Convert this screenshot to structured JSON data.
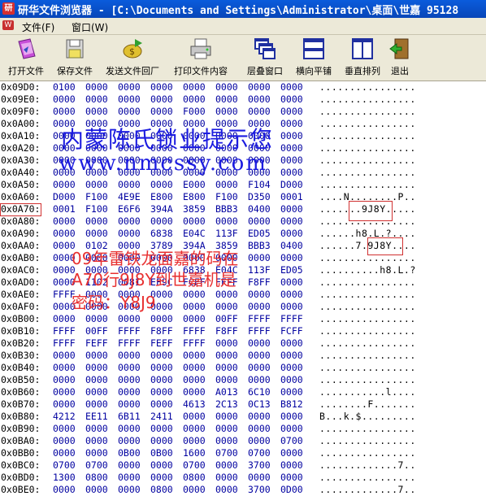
{
  "window": {
    "title": "研华文件浏览器 - [C:\\Documents and Settings\\Administrator\\桌面\\世嘉 95128",
    "colors": {
      "titlebar": "#0a5cdc",
      "chrome": "#ece9d8",
      "hex_values": "#0000a0",
      "highlight_box": "#d03030"
    }
  },
  "menu": {
    "items": [
      "文件(F)",
      "窗口(W)"
    ]
  },
  "toolbar": {
    "buttons": [
      {
        "label": "打开文件",
        "icon": "open-folder-icon"
      },
      {
        "label": "保存文件",
        "icon": "save-disk-icon"
      },
      {
        "label": "发送文件回厂",
        "icon": "send-icon"
      },
      {
        "label": "打印文件内容",
        "icon": "printer-icon"
      },
      {
        "label": "层叠窗口",
        "icon": "cascade-windows-icon"
      },
      {
        "label": "横向平铺",
        "icon": "tile-horizontal-icon"
      },
      {
        "label": "垂直排列",
        "icon": "tile-vertical-icon"
      },
      {
        "label": "退出",
        "icon": "exit-door-icon"
      }
    ]
  },
  "hex_rows": [
    {
      "addr": "0x09D0:",
      "values": [
        "0100",
        "0000",
        "0000",
        "0000",
        "0000",
        "0000",
        "0000",
        "0000"
      ],
      "ascii": "................"
    },
    {
      "addr": "0x09E0:",
      "values": [
        "0000",
        "0000",
        "0000",
        "0000",
        "0000",
        "0000",
        "0000",
        "0000"
      ],
      "ascii": "................"
    },
    {
      "addr": "0x09F0:",
      "values": [
        "0000",
        "0000",
        "0000",
        "0000",
        "F000",
        "0000",
        "0000",
        "0000"
      ],
      "ascii": "................"
    },
    {
      "addr": "0x0A00:",
      "values": [
        "0000",
        "0000",
        "0000",
        "0000",
        "0000",
        "0000",
        "0000",
        "0000"
      ],
      "ascii": "................"
    },
    {
      "addr": "0x0A10:",
      "values": [
        "0000",
        "0000",
        "0000",
        "0000",
        "0000",
        "0000",
        "0000",
        "0000"
      ],
      "ascii": "................"
    },
    {
      "addr": "0x0A20:",
      "values": [
        "0000",
        "0000",
        "0000",
        "0000",
        "0000",
        "0000",
        "0000",
        "0000"
      ],
      "ascii": "................"
    },
    {
      "addr": "0x0A30:",
      "values": [
        "0000",
        "0000",
        "0000",
        "0000",
        "0000",
        "0000",
        "0000",
        "0000"
      ],
      "ascii": "................"
    },
    {
      "addr": "0x0A40:",
      "values": [
        "0000",
        "0000",
        "0000",
        "0000",
        "0000",
        "0000",
        "0000",
        "0000"
      ],
      "ascii": "................"
    },
    {
      "addr": "0x0A50:",
      "values": [
        "0000",
        "0000",
        "0000",
        "0000",
        "E000",
        "0000",
        "F104",
        "D000"
      ],
      "ascii": "................"
    },
    {
      "addr": "0x0A60:",
      "values": [
        "D000",
        "F100",
        "4E9E",
        "E800",
        "E800",
        "F100",
        "D350",
        "0001"
      ],
      "ascii": "....N........P.."
    },
    {
      "addr": "0x0A70:",
      "values": [
        "0001",
        "F100",
        "E6F6",
        "394A",
        "3859",
        "BBB3",
        "0400",
        "0000"
      ],
      "ascii": ".......9J8Y....."
    },
    {
      "addr": "0x0A80:",
      "values": [
        "0000",
        "0000",
        "0000",
        "0000",
        "0000",
        "0000",
        "0000",
        "0000"
      ],
      "ascii": "................"
    },
    {
      "addr": "0x0A90:",
      "values": [
        "0000",
        "0000",
        "0000",
        "6838",
        "E04C",
        "113F",
        "ED05",
        "0000"
      ],
      "ascii": "......h8.L.?...."
    },
    {
      "addr": "0x0AA0:",
      "values": [
        "0000",
        "0102",
        "0000",
        "3789",
        "394A",
        "3859",
        "BBB3",
        "0400"
      ],
      "ascii": "......7.9J8Y...."
    },
    {
      "addr": "0x0AB0:",
      "values": [
        "0000",
        "0000",
        "0000",
        "0000",
        "0000",
        "0000",
        "0000",
        "0000"
      ],
      "ascii": "................"
    },
    {
      "addr": "0x0AC0:",
      "values": [
        "0000",
        "0000",
        "0000",
        "0000",
        "6838",
        "E04C",
        "113F",
        "ED05"
      ],
      "ascii": "..........h8.L.?"
    },
    {
      "addr": "0x0AD0:",
      "values": [
        "0000",
        "1102",
        "0081",
        "EF9C",
        "FCFF",
        "FFFF",
        "F8FF",
        "0000"
      ],
      "ascii": "................"
    },
    {
      "addr": "0x0AE0:",
      "values": [
        "FFFF",
        "0000",
        "0000",
        "0000",
        "0000",
        "0000",
        "0000",
        "0000"
      ],
      "ascii": "................"
    },
    {
      "addr": "0x0AF0:",
      "values": [
        "0000",
        "0000",
        "0000",
        "0000",
        "0000",
        "0000",
        "0000",
        "0000"
      ],
      "ascii": "................"
    },
    {
      "addr": "0x0B00:",
      "values": [
        "0000",
        "0000",
        "0000",
        "0000",
        "0000",
        "00FF",
        "FFFF",
        "FFFF"
      ],
      "ascii": "................"
    },
    {
      "addr": "0x0B10:",
      "values": [
        "FFFF",
        "00FF",
        "FFFF",
        "F8FF",
        "FFFF",
        "F8FF",
        "FFFF",
        "FCFF"
      ],
      "ascii": "................"
    },
    {
      "addr": "0x0B20:",
      "values": [
        "FFFF",
        "FEFF",
        "FFFF",
        "FEFF",
        "FFFF",
        "0000",
        "0000",
        "0000"
      ],
      "ascii": "................"
    },
    {
      "addr": "0x0B30:",
      "values": [
        "0000",
        "0000",
        "0000",
        "0000",
        "0000",
        "0000",
        "0000",
        "0000"
      ],
      "ascii": "................"
    },
    {
      "addr": "0x0B40:",
      "values": [
        "0000",
        "0000",
        "0000",
        "0000",
        "0000",
        "0000",
        "0000",
        "0000"
      ],
      "ascii": "................"
    },
    {
      "addr": "0x0B50:",
      "values": [
        "0000",
        "0000",
        "0000",
        "0000",
        "0000",
        "0000",
        "0000",
        "0000"
      ],
      "ascii": "................"
    },
    {
      "addr": "0x0B60:",
      "values": [
        "0000",
        "0000",
        "0000",
        "0000",
        "0000",
        "A013",
        "6C10",
        "0000"
      ],
      "ascii": "...........l...."
    },
    {
      "addr": "0x0B70:",
      "values": [
        "0000",
        "0000",
        "0000",
        "0000",
        "4613",
        "2C13",
        "0C13",
        "B812"
      ],
      "ascii": "........F......."
    },
    {
      "addr": "0x0B80:",
      "values": [
        "4212",
        "EE11",
        "6B11",
        "2411",
        "0000",
        "0000",
        "0000",
        "0000"
      ],
      "ascii": "B...k.$........."
    },
    {
      "addr": "0x0B90:",
      "values": [
        "0000",
        "0000",
        "0000",
        "0000",
        "0000",
        "0000",
        "0000",
        "0000"
      ],
      "ascii": "................"
    },
    {
      "addr": "0x0BA0:",
      "values": [
        "0000",
        "0000",
        "0000",
        "0000",
        "0000",
        "0000",
        "0000",
        "0700"
      ],
      "ascii": "................"
    },
    {
      "addr": "0x0BB0:",
      "values": [
        "0000",
        "0000",
        "0B00",
        "0B00",
        "1600",
        "0700",
        "0700",
        "0000"
      ],
      "ascii": "................"
    },
    {
      "addr": "0x0BC0:",
      "values": [
        "0700",
        "0700",
        "0000",
        "0000",
        "0700",
        "0000",
        "3700",
        "0000"
      ],
      "ascii": ".............7.."
    },
    {
      "addr": "0x0BD0:",
      "values": [
        "1300",
        "0800",
        "0000",
        "0000",
        "0800",
        "0000",
        "0000",
        "0000"
      ],
      "ascii": "................"
    },
    {
      "addr": "0x0BE0:",
      "values": [
        "0000",
        "0000",
        "0000",
        "0800",
        "0000",
        "0000",
        "3700",
        "0D00"
      ],
      "ascii": ".............7.."
    }
  ],
  "watermark": {
    "line1": "内蒙陈氏锁业提示您",
    "line2": "www.nmcssy.com",
    "red_line1": "09年雷铁龙面嘉的码在",
    "red_line2": "A70行9J8Y到世嘉机是",
    "red_line3": "密码：Y8J9"
  }
}
